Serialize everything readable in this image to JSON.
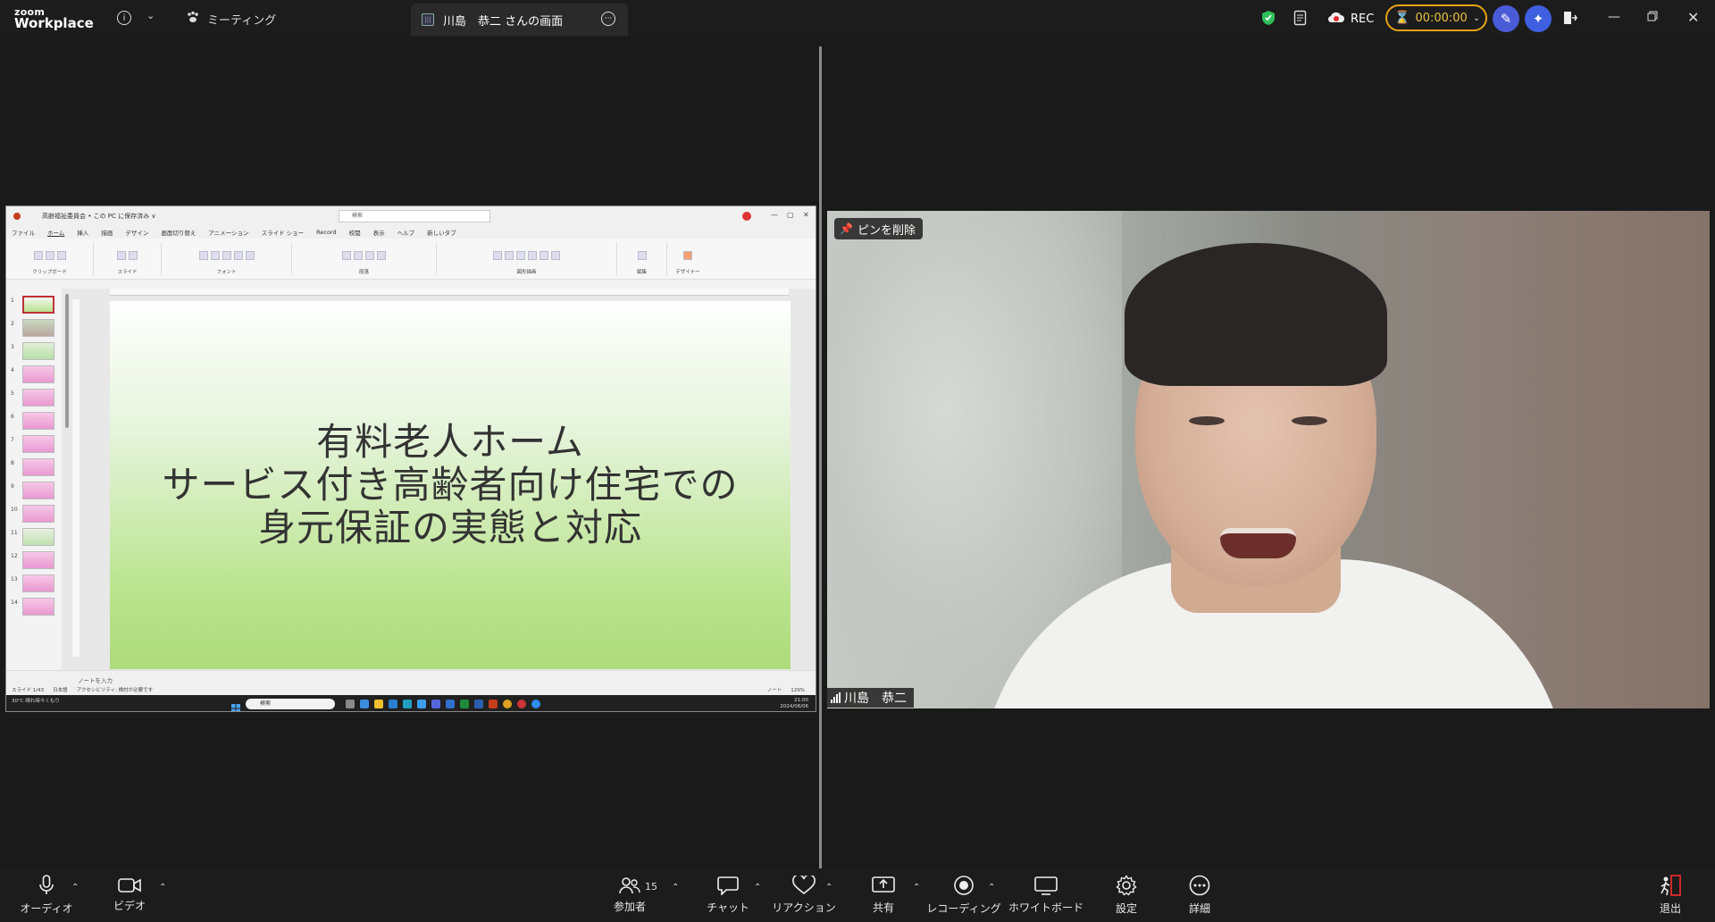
{
  "app": {
    "logo_top": "zoom",
    "logo_bottom": "Workplace"
  },
  "header": {
    "meeting_label": "ミーティング",
    "share_tab_label": "川島　恭二 さんの画面",
    "rec_label": "REC",
    "timer": "00:00:00",
    "accent": "#e8a317"
  },
  "shared_screen": {
    "pp_filename": "高齢福祉委員会 • この PC に保存済み ∨",
    "pp_search_placeholder": "検索",
    "pp_menu": [
      "ファイル",
      "ホーム",
      "挿入",
      "描画",
      "デザイン",
      "画面切り替え",
      "アニメーション",
      "スライド ショー",
      "Record",
      "校閲",
      "表示",
      "ヘルプ",
      "新しいタブ"
    ],
    "pp_ribbon_groups": [
      "クリップボード",
      "スライド",
      "フォント",
      "段落",
      "図形描画",
      "編集",
      "デザイナー"
    ],
    "slide_lines": [
      "有料老人ホーム",
      "サービス付き高齢者向け住宅での",
      "身元保証の実態と対応"
    ],
    "thumb_numbers": [
      "1",
      "2",
      "3",
      "4",
      "5",
      "6",
      "7",
      "8",
      "9",
      "10",
      "11",
      "12",
      "13",
      "14"
    ],
    "notes_placeholder": "ノートを入力",
    "status_slide": "スライド 1/43",
    "status_lang": "日本語",
    "status_access": "アクセシビリティ: 検討が必要です",
    "status_notes": "ノート",
    "status_zoom": "129%",
    "taskbar_search": "検索",
    "taskbar_weather": "30°C 晴れ時々くもり",
    "taskbar_time": "21:00",
    "taskbar_date": "2024/08/06"
  },
  "video": {
    "unpin_label": "ピンを削除",
    "participant_name": "川島　恭二"
  },
  "toolbar": {
    "audio": "オーディオ",
    "video": "ビデオ",
    "participants": "参加者",
    "participants_count": "15",
    "chat": "チャット",
    "reactions": "リアクション",
    "share": "共有",
    "recording": "レコーディング",
    "whiteboard": "ホワイトボード",
    "settings": "設定",
    "more": "詳細",
    "leave": "退出"
  }
}
